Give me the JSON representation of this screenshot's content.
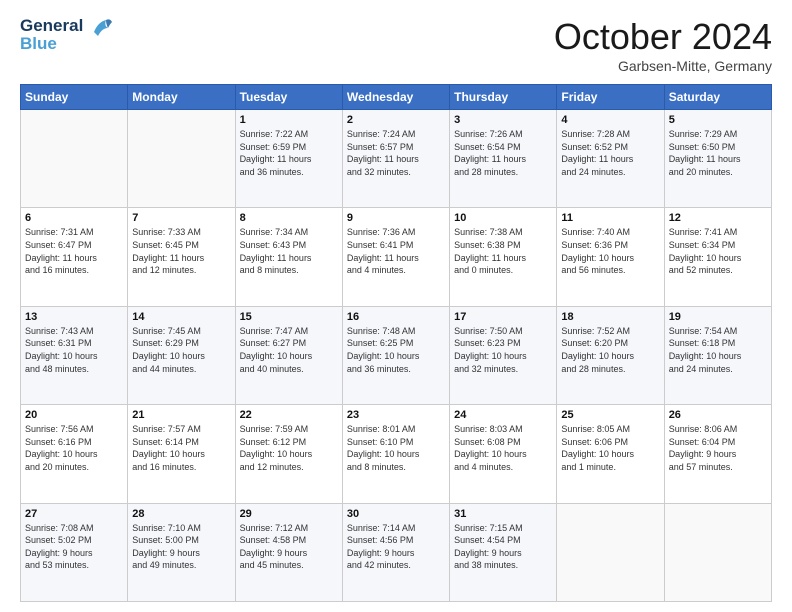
{
  "header": {
    "logo_line1": "General",
    "logo_line2": "Blue",
    "month_title": "October 2024",
    "location": "Garbsen-Mitte, Germany"
  },
  "weekdays": [
    "Sunday",
    "Monday",
    "Tuesday",
    "Wednesday",
    "Thursday",
    "Friday",
    "Saturday"
  ],
  "weeks": [
    [
      {
        "day": "",
        "info": ""
      },
      {
        "day": "",
        "info": ""
      },
      {
        "day": "1",
        "info": "Sunrise: 7:22 AM\nSunset: 6:59 PM\nDaylight: 11 hours\nand 36 minutes."
      },
      {
        "day": "2",
        "info": "Sunrise: 7:24 AM\nSunset: 6:57 PM\nDaylight: 11 hours\nand 32 minutes."
      },
      {
        "day": "3",
        "info": "Sunrise: 7:26 AM\nSunset: 6:54 PM\nDaylight: 11 hours\nand 28 minutes."
      },
      {
        "day": "4",
        "info": "Sunrise: 7:28 AM\nSunset: 6:52 PM\nDaylight: 11 hours\nand 24 minutes."
      },
      {
        "day": "5",
        "info": "Sunrise: 7:29 AM\nSunset: 6:50 PM\nDaylight: 11 hours\nand 20 minutes."
      }
    ],
    [
      {
        "day": "6",
        "info": "Sunrise: 7:31 AM\nSunset: 6:47 PM\nDaylight: 11 hours\nand 16 minutes."
      },
      {
        "day": "7",
        "info": "Sunrise: 7:33 AM\nSunset: 6:45 PM\nDaylight: 11 hours\nand 12 minutes."
      },
      {
        "day": "8",
        "info": "Sunrise: 7:34 AM\nSunset: 6:43 PM\nDaylight: 11 hours\nand 8 minutes."
      },
      {
        "day": "9",
        "info": "Sunrise: 7:36 AM\nSunset: 6:41 PM\nDaylight: 11 hours\nand 4 minutes."
      },
      {
        "day": "10",
        "info": "Sunrise: 7:38 AM\nSunset: 6:38 PM\nDaylight: 11 hours\nand 0 minutes."
      },
      {
        "day": "11",
        "info": "Sunrise: 7:40 AM\nSunset: 6:36 PM\nDaylight: 10 hours\nand 56 minutes."
      },
      {
        "day": "12",
        "info": "Sunrise: 7:41 AM\nSunset: 6:34 PM\nDaylight: 10 hours\nand 52 minutes."
      }
    ],
    [
      {
        "day": "13",
        "info": "Sunrise: 7:43 AM\nSunset: 6:31 PM\nDaylight: 10 hours\nand 48 minutes."
      },
      {
        "day": "14",
        "info": "Sunrise: 7:45 AM\nSunset: 6:29 PM\nDaylight: 10 hours\nand 44 minutes."
      },
      {
        "day": "15",
        "info": "Sunrise: 7:47 AM\nSunset: 6:27 PM\nDaylight: 10 hours\nand 40 minutes."
      },
      {
        "day": "16",
        "info": "Sunrise: 7:48 AM\nSunset: 6:25 PM\nDaylight: 10 hours\nand 36 minutes."
      },
      {
        "day": "17",
        "info": "Sunrise: 7:50 AM\nSunset: 6:23 PM\nDaylight: 10 hours\nand 32 minutes."
      },
      {
        "day": "18",
        "info": "Sunrise: 7:52 AM\nSunset: 6:20 PM\nDaylight: 10 hours\nand 28 minutes."
      },
      {
        "day": "19",
        "info": "Sunrise: 7:54 AM\nSunset: 6:18 PM\nDaylight: 10 hours\nand 24 minutes."
      }
    ],
    [
      {
        "day": "20",
        "info": "Sunrise: 7:56 AM\nSunset: 6:16 PM\nDaylight: 10 hours\nand 20 minutes."
      },
      {
        "day": "21",
        "info": "Sunrise: 7:57 AM\nSunset: 6:14 PM\nDaylight: 10 hours\nand 16 minutes."
      },
      {
        "day": "22",
        "info": "Sunrise: 7:59 AM\nSunset: 6:12 PM\nDaylight: 10 hours\nand 12 minutes."
      },
      {
        "day": "23",
        "info": "Sunrise: 8:01 AM\nSunset: 6:10 PM\nDaylight: 10 hours\nand 8 minutes."
      },
      {
        "day": "24",
        "info": "Sunrise: 8:03 AM\nSunset: 6:08 PM\nDaylight: 10 hours\nand 4 minutes."
      },
      {
        "day": "25",
        "info": "Sunrise: 8:05 AM\nSunset: 6:06 PM\nDaylight: 10 hours\nand 1 minute."
      },
      {
        "day": "26",
        "info": "Sunrise: 8:06 AM\nSunset: 6:04 PM\nDaylight: 9 hours\nand 57 minutes."
      }
    ],
    [
      {
        "day": "27",
        "info": "Sunrise: 7:08 AM\nSunset: 5:02 PM\nDaylight: 9 hours\nand 53 minutes."
      },
      {
        "day": "28",
        "info": "Sunrise: 7:10 AM\nSunset: 5:00 PM\nDaylight: 9 hours\nand 49 minutes."
      },
      {
        "day": "29",
        "info": "Sunrise: 7:12 AM\nSunset: 4:58 PM\nDaylight: 9 hours\nand 45 minutes."
      },
      {
        "day": "30",
        "info": "Sunrise: 7:14 AM\nSunset: 4:56 PM\nDaylight: 9 hours\nand 42 minutes."
      },
      {
        "day": "31",
        "info": "Sunrise: 7:15 AM\nSunset: 4:54 PM\nDaylight: 9 hours\nand 38 minutes."
      },
      {
        "day": "",
        "info": ""
      },
      {
        "day": "",
        "info": ""
      }
    ]
  ]
}
